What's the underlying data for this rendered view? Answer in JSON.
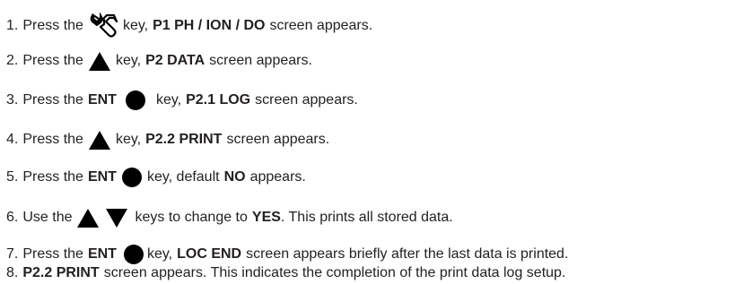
{
  "steps": [
    {
      "num": "1.",
      "t1": "Press the",
      "t2": "key,",
      "b1": "P1 PH / ION / DO",
      "t3": "screen appears.",
      "icon": "wrench-icon"
    },
    {
      "num": "2.",
      "t1": "Press the",
      "t2": "key,",
      "b1": "P2 DATA",
      "t3": "screen appears.",
      "icon": "up-arrow-key-icon"
    },
    {
      "num": "3.",
      "t1": "Press the",
      "b0": "ENT",
      "t2": "key,",
      "b1": "P2.1 LOG",
      "t3": "screen appears.",
      "icon": "enter-key-icon"
    },
    {
      "num": "4.",
      "t1": "Press the",
      "t2": "key,",
      "b1": "P2.2 PRINT",
      "t3": "screen appears.",
      "icon": "up-arrow-key-icon"
    },
    {
      "num": "5.",
      "t1": "Press the",
      "b0": "ENT",
      "t2": "key, default",
      "b1": "NO",
      "t3": "appears.",
      "icon": "enter-key-icon"
    },
    {
      "num": "6.",
      "t1": "Use the",
      "t2": "keys to change to",
      "b1": "YES",
      "t3": ". This prints all stored data.",
      "icons": [
        "up-arrow-key-icon",
        "down-arrow-key-icon"
      ]
    },
    {
      "num": "7.",
      "t1": "Press the",
      "b0": "ENT",
      "t2": "key,",
      "b1": "LOC END",
      "t3": "screen appears briefly after the last data is printed.",
      "icon": "enter-key-icon"
    },
    {
      "num": "8.",
      "b1": "P2.2 PRINT",
      "t3": "screen appears. This indicates the completion of the print data log setup."
    }
  ]
}
